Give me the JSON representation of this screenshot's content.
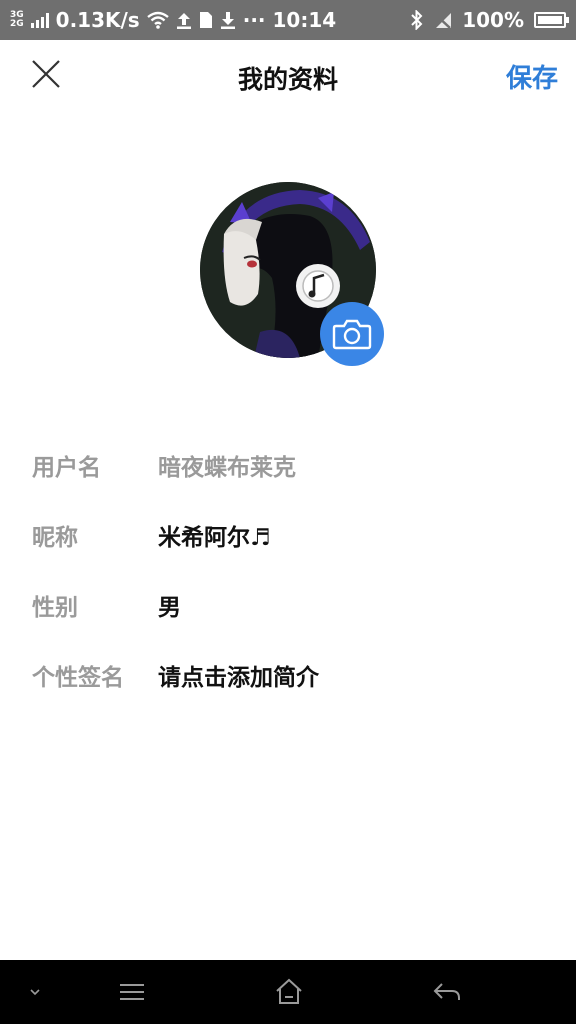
{
  "status_bar": {
    "network_top": "3G",
    "network_bottom": "2G",
    "speed": "0.13K/s",
    "dots": "···",
    "time": "10:14",
    "battery": "100%",
    "battery_level": 1.0
  },
  "header": {
    "title": "我的资料",
    "save_label": "保存"
  },
  "profile": {
    "rows": [
      {
        "label": "用户名",
        "value": "暗夜蝶布莱克"
      },
      {
        "label": "昵称",
        "value": "米希阿尔♬"
      },
      {
        "label": "性别",
        "value": "男"
      },
      {
        "label": "个性签名",
        "value": "请点击添加简介"
      }
    ]
  },
  "icons": {
    "close": "close-icon",
    "camera": "camera-icon",
    "nav_collapse": "chevron-down-icon",
    "nav_menu": "menu-icon",
    "nav_home": "home-icon",
    "nav_back": "back-icon"
  },
  "colors": {
    "accent": "#2f7ed8",
    "camera_button": "#3a86e6",
    "status_bar": "#6f6f6f",
    "label_gray": "#9a9a9a",
    "nav_bar": "#000000"
  }
}
